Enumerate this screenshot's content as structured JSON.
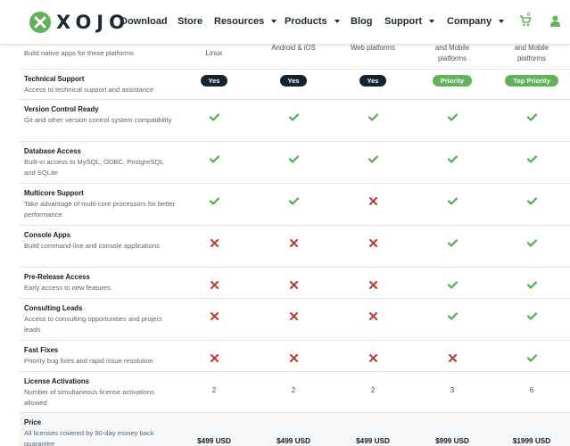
{
  "nav": {
    "logo_text": "XOJO",
    "brand_color": "#62b25a",
    "items": [
      {
        "label": "Download",
        "dropdown": false
      },
      {
        "label": "Store",
        "dropdown": false
      },
      {
        "label": "Resources",
        "dropdown": true
      },
      {
        "label": "Products",
        "dropdown": true
      },
      {
        "label": "Blog",
        "dropdown": false
      },
      {
        "label": "Support",
        "dropdown": true
      },
      {
        "label": "Company",
        "dropdown": true
      }
    ],
    "cart_count": "0",
    "icons": [
      "cart-icon",
      "user-icon"
    ]
  },
  "table": {
    "partial_row": {
      "desc": "Build native apps for these platforms",
      "columns": [
        "Linux",
        "Android & iOS",
        "Web platforms",
        "and Mobile platforms",
        "and Mobile platforms"
      ]
    },
    "rows": [
      {
        "title": "Technical Support",
        "desc": "Access to technical support and assistance",
        "cells": [
          {
            "type": "pill",
            "style": "dark",
            "text": "Yes"
          },
          {
            "type": "pill",
            "style": "dark",
            "text": "Yes"
          },
          {
            "type": "pill",
            "style": "dark",
            "text": "Yes"
          },
          {
            "type": "pill",
            "style": "green",
            "text": "Priority"
          },
          {
            "type": "pill",
            "style": "green",
            "text": "Top Priority"
          }
        ]
      },
      {
        "title": "Version Control Ready",
        "desc": "Git and other version control system compatibility",
        "cells": [
          {
            "type": "check"
          },
          {
            "type": "check"
          },
          {
            "type": "check"
          },
          {
            "type": "check"
          },
          {
            "type": "check"
          }
        ]
      },
      {
        "title": "Database Access",
        "desc": "Built-in access to MySQL, ODBC, PostgreSQL and SQLite",
        "cells": [
          {
            "type": "check"
          },
          {
            "type": "check"
          },
          {
            "type": "check"
          },
          {
            "type": "check"
          },
          {
            "type": "check"
          }
        ]
      },
      {
        "title": "Multicore Support",
        "desc": "Take advantage of multi-core processors for better performance",
        "cells": [
          {
            "type": "check"
          },
          {
            "type": "check"
          },
          {
            "type": "cross"
          },
          {
            "type": "check"
          },
          {
            "type": "check"
          }
        ]
      },
      {
        "title": "Console Apps",
        "desc": "Build command-line and console applications",
        "cells": [
          {
            "type": "cross"
          },
          {
            "type": "cross"
          },
          {
            "type": "cross"
          },
          {
            "type": "check"
          },
          {
            "type": "check"
          }
        ]
      },
      {
        "title": "Pre-Release Access",
        "desc": "Early access to new features",
        "cells": [
          {
            "type": "cross"
          },
          {
            "type": "cross"
          },
          {
            "type": "cross"
          },
          {
            "type": "check"
          },
          {
            "type": "check"
          }
        ]
      },
      {
        "title": "Consulting Leads",
        "desc": "Access to consulting opportunities and project leads",
        "cells": [
          {
            "type": "cross"
          },
          {
            "type": "cross"
          },
          {
            "type": "cross"
          },
          {
            "type": "check"
          },
          {
            "type": "check"
          }
        ]
      },
      {
        "title": "Fast Fixes",
        "desc": "Priority bug fixes and rapid issue resolution",
        "cells": [
          {
            "type": "cross"
          },
          {
            "type": "cross"
          },
          {
            "type": "cross"
          },
          {
            "type": "cross"
          },
          {
            "type": "check"
          }
        ]
      },
      {
        "title": "License Activations",
        "desc": "Number of simultaneous license activations allowed",
        "cells": [
          {
            "type": "text",
            "text": "2"
          },
          {
            "type": "text",
            "text": "2"
          },
          {
            "type": "text",
            "text": "2"
          },
          {
            "type": "text",
            "text": "3"
          },
          {
            "type": "text",
            "text": "6"
          }
        ]
      },
      {
        "title": "Price",
        "desc": "All licenses covered by 90-day money back guarantee",
        "cells": [
          {
            "type": "price",
            "text": "$499 USD"
          },
          {
            "type": "price",
            "text": "$499 USD"
          },
          {
            "type": "price",
            "text": "$499 USD"
          },
          {
            "type": "price",
            "text": "$999 USD"
          },
          {
            "type": "price",
            "text": "$1999 USD"
          }
        ]
      }
    ],
    "colors": {
      "check": "#4caf50",
      "cross": "#c0392b",
      "pill_dark": "#142430",
      "pill_green": "#62b25a"
    }
  }
}
